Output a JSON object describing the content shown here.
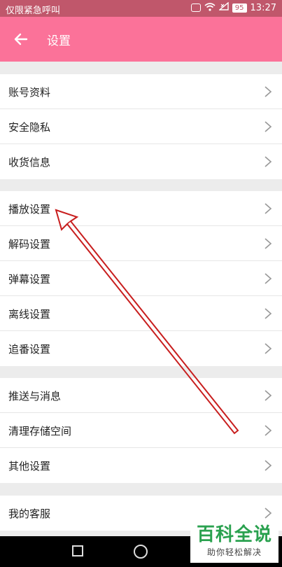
{
  "status_bar": {
    "carrier": "仅限紧急呼叫",
    "battery": "95",
    "time": "13:27"
  },
  "app_bar": {
    "title": "设置",
    "back_icon": "arrow-left-icon"
  },
  "groups": [
    {
      "items": [
        "账号资料",
        "安全隐私",
        "收货信息"
      ]
    },
    {
      "items": [
        "播放设置",
        "解码设置",
        "弹幕设置",
        "离线设置",
        "追番设置"
      ]
    },
    {
      "items": [
        "推送与消息",
        "清理存储空间",
        "其他设置"
      ]
    },
    {
      "items": [
        "我的客服"
      ]
    }
  ],
  "watermark": {
    "main": "百科全说",
    "sub": "助你轻松解决"
  },
  "colors": {
    "app_bar": "#fb7299",
    "status_bar": "#c0576b",
    "annotation_arrow": "#c81e1e",
    "watermark_green": "#2aa14f"
  }
}
